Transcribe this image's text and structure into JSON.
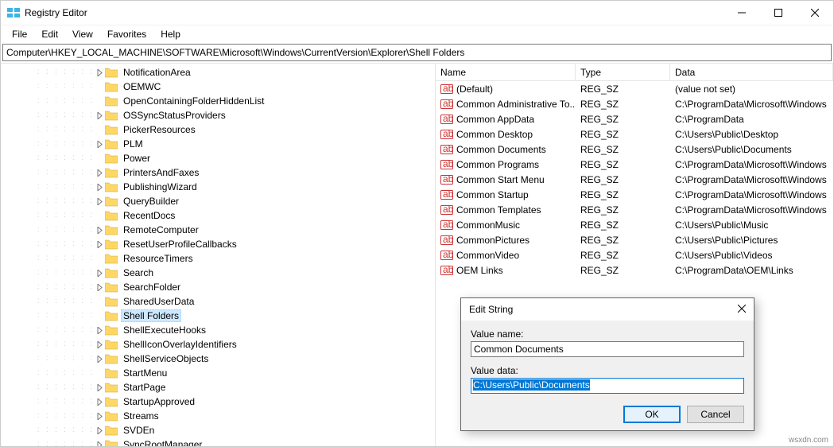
{
  "titlebar": {
    "title": "Registry Editor"
  },
  "menubar": [
    "File",
    "Edit",
    "View",
    "Favorites",
    "Help"
  ],
  "path": "Computer\\HKEY_LOCAL_MACHINE\\SOFTWARE\\Microsoft\\Windows\\CurrentVersion\\Explorer\\Shell Folders",
  "tree": [
    {
      "label": "NotificationArea",
      "exp": true
    },
    {
      "label": "OEMWC",
      "exp": false
    },
    {
      "label": "OpenContainingFolderHiddenList",
      "exp": false
    },
    {
      "label": "OSSyncStatusProviders",
      "exp": true
    },
    {
      "label": "PickerResources",
      "exp": false
    },
    {
      "label": "PLM",
      "exp": true
    },
    {
      "label": "Power",
      "exp": false
    },
    {
      "label": "PrintersAndFaxes",
      "exp": true
    },
    {
      "label": "PublishingWizard",
      "exp": true
    },
    {
      "label": "QueryBuilder",
      "exp": true
    },
    {
      "label": "RecentDocs",
      "exp": false
    },
    {
      "label": "RemoteComputer",
      "exp": true
    },
    {
      "label": "ResetUserProfileCallbacks",
      "exp": true
    },
    {
      "label": "ResourceTimers",
      "exp": false
    },
    {
      "label": "Search",
      "exp": true
    },
    {
      "label": "SearchFolder",
      "exp": true
    },
    {
      "label": "SharedUserData",
      "exp": false
    },
    {
      "label": "Shell Folders",
      "exp": false,
      "selected": true
    },
    {
      "label": "ShellExecuteHooks",
      "exp": true
    },
    {
      "label": "ShellIconOverlayIdentifiers",
      "exp": true
    },
    {
      "label": "ShellServiceObjects",
      "exp": true
    },
    {
      "label": "StartMenu",
      "exp": false
    },
    {
      "label": "StartPage",
      "exp": true
    },
    {
      "label": "StartupApproved",
      "exp": true
    },
    {
      "label": "Streams",
      "exp": true
    },
    {
      "label": "SVDEn",
      "exp": true
    },
    {
      "label": "SyncRootManager",
      "exp": true
    }
  ],
  "list": {
    "columns": {
      "name": "Name",
      "type": "Type",
      "data": "Data"
    },
    "rows": [
      {
        "name": "(Default)",
        "type": "REG_SZ",
        "data": "(value not set)"
      },
      {
        "name": "Common Administrative To...",
        "type": "REG_SZ",
        "data": "C:\\ProgramData\\Microsoft\\Windows"
      },
      {
        "name": "Common AppData",
        "type": "REG_SZ",
        "data": "C:\\ProgramData"
      },
      {
        "name": "Common Desktop",
        "type": "REG_SZ",
        "data": "C:\\Users\\Public\\Desktop"
      },
      {
        "name": "Common Documents",
        "type": "REG_SZ",
        "data": "C:\\Users\\Public\\Documents"
      },
      {
        "name": "Common Programs",
        "type": "REG_SZ",
        "data": "C:\\ProgramData\\Microsoft\\Windows"
      },
      {
        "name": "Common Start Menu",
        "type": "REG_SZ",
        "data": "C:\\ProgramData\\Microsoft\\Windows"
      },
      {
        "name": "Common Startup",
        "type": "REG_SZ",
        "data": "C:\\ProgramData\\Microsoft\\Windows"
      },
      {
        "name": "Common Templates",
        "type": "REG_SZ",
        "data": "C:\\ProgramData\\Microsoft\\Windows"
      },
      {
        "name": "CommonMusic",
        "type": "REG_SZ",
        "data": "C:\\Users\\Public\\Music"
      },
      {
        "name": "CommonPictures",
        "type": "REG_SZ",
        "data": "C:\\Users\\Public\\Pictures"
      },
      {
        "name": "CommonVideo",
        "type": "REG_SZ",
        "data": "C:\\Users\\Public\\Videos"
      },
      {
        "name": "OEM Links",
        "type": "REG_SZ",
        "data": "C:\\ProgramData\\OEM\\Links"
      }
    ]
  },
  "dialog": {
    "title": "Edit String",
    "value_name_label": "Value name:",
    "value_name": "Common Documents",
    "value_data_label": "Value data:",
    "value_data": "C:\\Users\\Public\\Documents",
    "ok": "OK",
    "cancel": "Cancel"
  },
  "watermark": "wsxdn.com"
}
